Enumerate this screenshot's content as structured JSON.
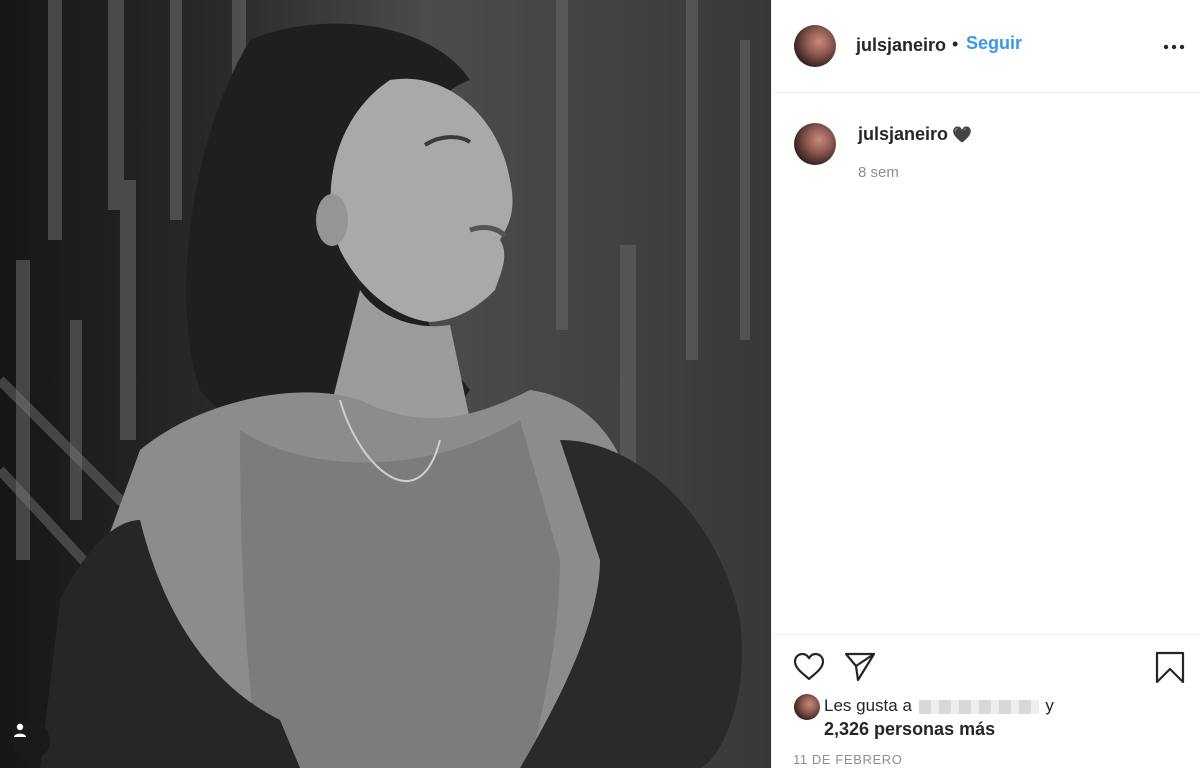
{
  "post": {
    "username": "julsjaneiro",
    "separator": "•",
    "follow_label": "Seguir",
    "caption_emoji": "🖤",
    "time_ago": "8 sem",
    "liked_by_prefix": "Les gusta a",
    "liked_by_suffix": "y",
    "likes_count": "2,326 personas más",
    "date": "11 DE FEBRERO"
  },
  "icons": {
    "more": "more-options-icon",
    "like": "heart-outline-icon",
    "share": "paper-plane-icon",
    "save": "bookmark-icon",
    "tag": "user-tag-icon"
  },
  "colors": {
    "accent": "#3897f0",
    "text": "#262626",
    "muted": "#8e8e8e",
    "divider": "#efefef"
  }
}
